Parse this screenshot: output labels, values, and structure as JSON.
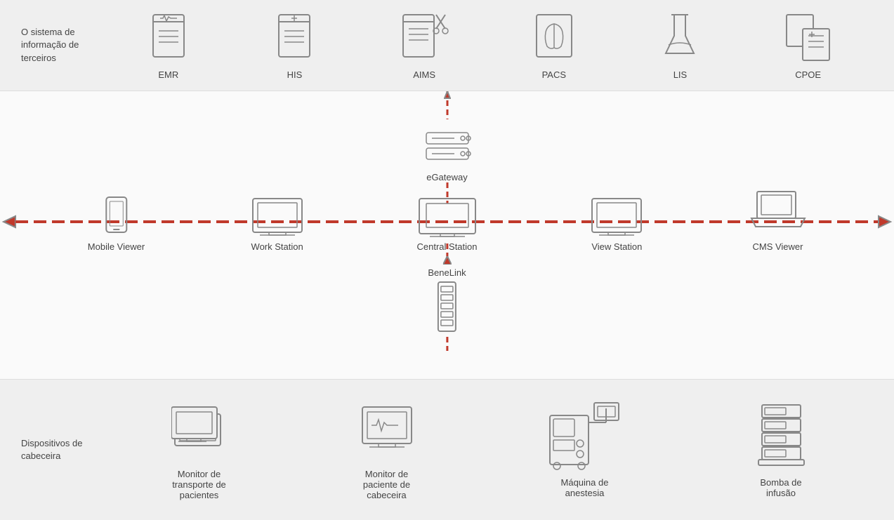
{
  "top": {
    "label": "O sistema de informação de terceiros",
    "items": [
      {
        "id": "emr",
        "label": "EMR"
      },
      {
        "id": "his",
        "label": "HIS"
      },
      {
        "id": "aims",
        "label": "AIMS"
      },
      {
        "id": "pacs",
        "label": "PACS"
      },
      {
        "id": "lis",
        "label": "LIS"
      },
      {
        "id": "cpoe",
        "label": "CPOE"
      }
    ]
  },
  "middle": {
    "egateway_label": "eGateway",
    "benelink_label": "BeneLink",
    "central_label": "Central Station",
    "nodes": [
      {
        "id": "mobile-viewer",
        "label": "Mobile Viewer",
        "left": "13%"
      },
      {
        "id": "work-station",
        "label": "Work Station",
        "left": "31%"
      },
      {
        "id": "view-station",
        "label": "View Station",
        "left": "69%"
      },
      {
        "id": "cms-viewer",
        "label": "CMS Viewer",
        "left": "87%"
      }
    ]
  },
  "bottom": {
    "label": "Dispositivos de cabeceira",
    "items": [
      {
        "id": "monitor-transport",
        "label": "Monitor de\ntransporte de\npacientes"
      },
      {
        "id": "monitor-cabeceira",
        "label": "Monitor de\npaciente de\ncabeceira"
      },
      {
        "id": "maquina-anestesia",
        "label": "Máquina de\nanestesia"
      },
      {
        "id": "bomba-infusao",
        "label": "Bomba de\ninfusão"
      }
    ]
  },
  "colors": {
    "red": "#c0392b",
    "icon_stroke": "#888888",
    "text": "#444444",
    "bg_top": "#efefef",
    "bg_mid": "#fafafa",
    "bg_bot": "#efefef"
  }
}
